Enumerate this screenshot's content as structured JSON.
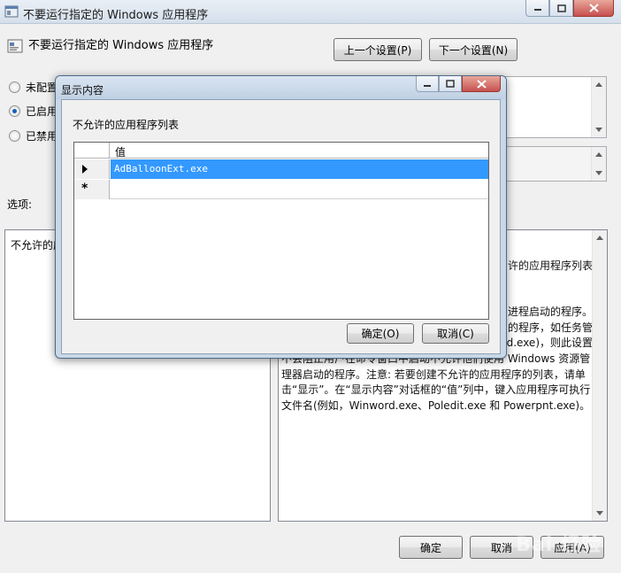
{
  "window": {
    "title": "不要运行指定的 Windows 应用程序"
  },
  "setting": {
    "title": "不要运行指定的 Windows 应用程序",
    "prev_label": "上一个设置(P)",
    "next_label": "下一个设置(N)"
  },
  "radios": [
    {
      "label": "未配置",
      "checked": false
    },
    {
      "label": "已启用",
      "checked": true
    },
    {
      "label": "已禁用",
      "checked": false
    }
  ],
  "options": {
    "label": "选项:",
    "pane_text": "不允许的应"
  },
  "help": {
    "lines": [
      "许的应用程序列表",
      "",
      "进程启动的程序。",
      "的程序，如任务管",
      "d.exe)，则此设置",
      "不会阻止用户在命令窗口中启动不允许他们使用 Windows 资源管理器启动的程序。注意: 若要创建不允许的应用程序的列表，请单击“显示”。在“显示内容”对话框的“值”列中，键入应用程序可执行文件名(例如，Winword.exe、Poledit.exe 和 Powerpnt.exe)。"
    ]
  },
  "footer": {
    "ok_label": "确定",
    "cancel_label": "取消",
    "apply_label": "应用(A)"
  },
  "dialog": {
    "title": "显示内容",
    "list_label": "不允许的应用程序列表",
    "column_header": "值",
    "rows": [
      {
        "value": "AdBalloonExt.exe",
        "selected": true
      }
    ],
    "new_row_glyph": "*",
    "ok_label": "确定(O)",
    "cancel_label": "取消(C)"
  },
  "watermark": "Bai 经验"
}
